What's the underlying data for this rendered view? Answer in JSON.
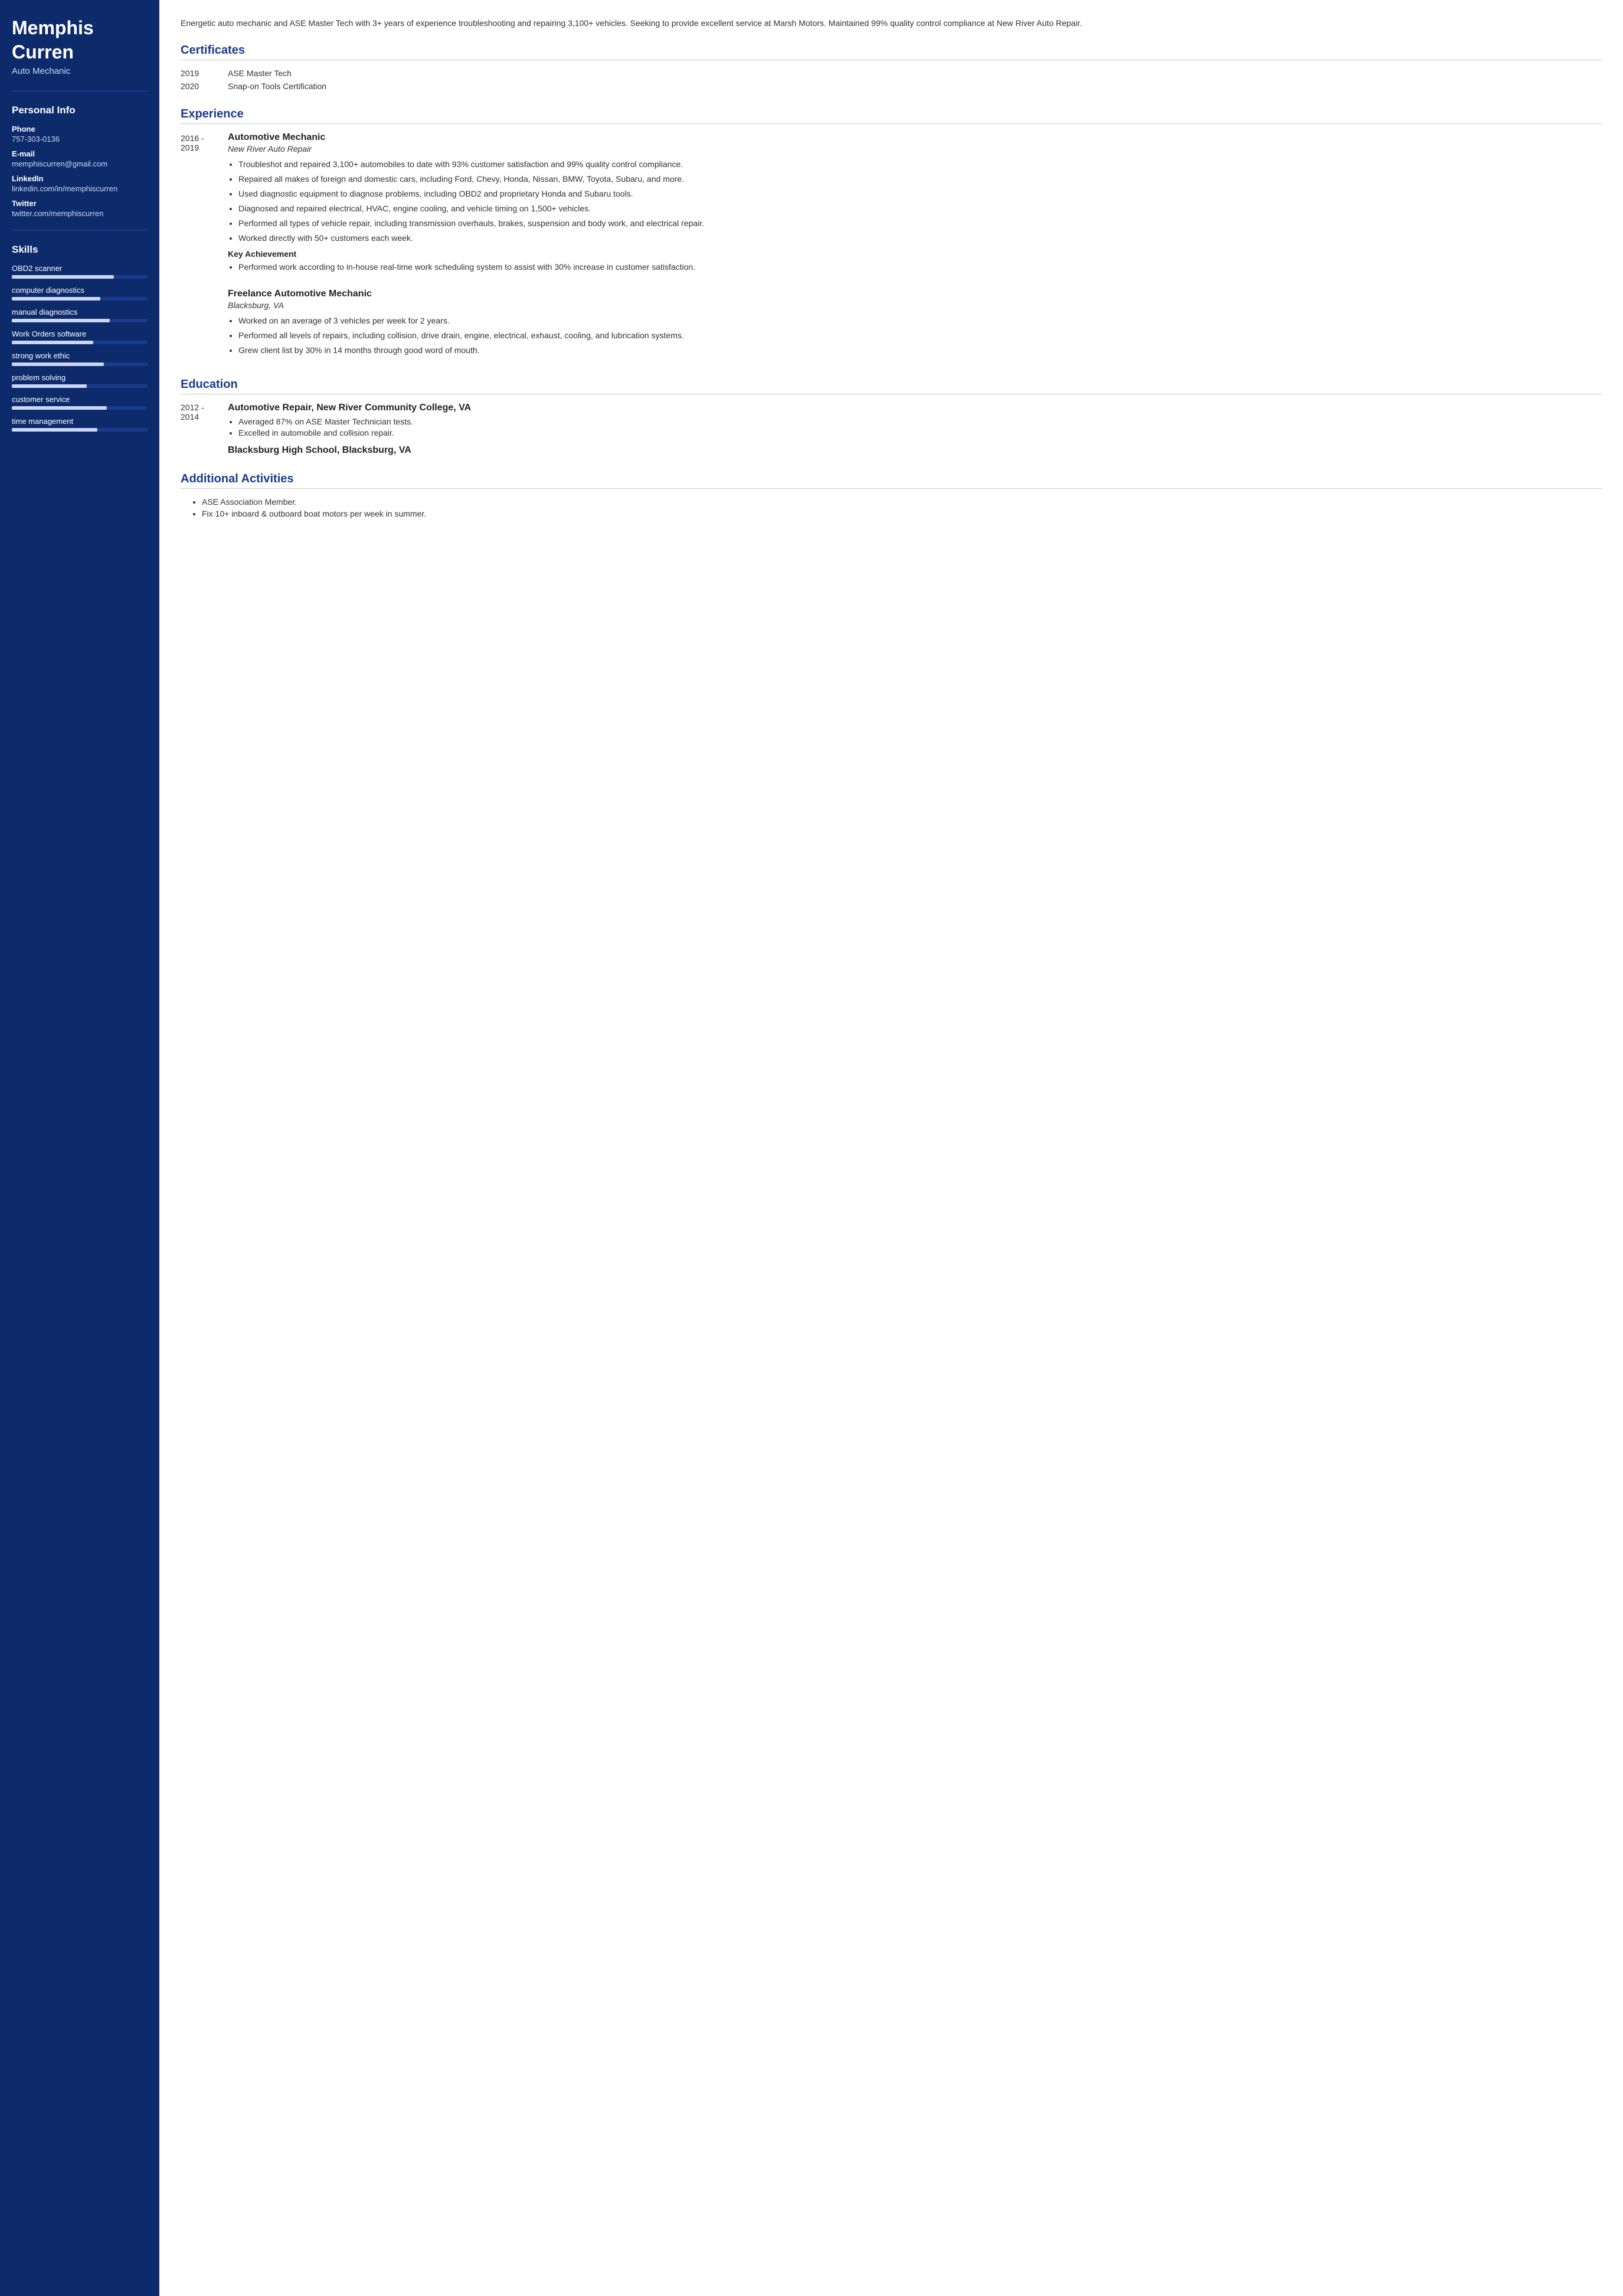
{
  "sidebar": {
    "name": "Memphis\nCurren",
    "name_line1": "Memphis",
    "name_line2": "Curren",
    "title": "Auto Mechanic",
    "personal_info_heading": "Personal Info",
    "phone_label": "Phone",
    "phone_value": "757-303-0136",
    "email_label": "E-mail",
    "email_value": "memphiscurren@gmail.com",
    "linkedin_label": "LinkedIn",
    "linkedin_value": "linkedin.com/in/memphiscurren",
    "twitter_label": "Twitter",
    "twitter_value": "twitter.com/memphiscurren",
    "skills_heading": "Skills",
    "skills": [
      {
        "name": "OBD2 scanner",
        "fill": 75,
        "total": 100
      },
      {
        "name": "computer diagnostics",
        "fill": 65,
        "total": 100
      },
      {
        "name": "manual diagnostics",
        "fill": 72,
        "total": 100
      },
      {
        "name": "Work Orders software",
        "fill": 60,
        "total": 100
      },
      {
        "name": "strong work ethic",
        "fill": 68,
        "total": 100
      },
      {
        "name": "problem solving",
        "fill": 55,
        "total": 100
      },
      {
        "name": "customer service",
        "fill": 70,
        "total": 100
      },
      {
        "name": "time management",
        "fill": 63,
        "total": 100
      }
    ]
  },
  "main": {
    "summary": "Energetic auto mechanic and ASE Master Tech with 3+ years of experience troubleshooting and repairing 3,100+ vehicles. Seeking to provide excellent service at Marsh Motors. Maintained 99% quality control compliance at New River Auto Repair.",
    "certificates_heading": "Certificates",
    "certificates": [
      {
        "year": "2019",
        "name": "ASE Master Tech"
      },
      {
        "year": "2020",
        "name": "Snap-on Tools Certification"
      }
    ],
    "experience_heading": "Experience",
    "experience": [
      {
        "dates": "2016 -\n2019",
        "title": "Automotive Mechanic",
        "company": "New River Auto Repair",
        "bullets": [
          "Troubleshot and repaired 3,100+ automobiles to date with 93% customer satisfaction and 99% quality control compliance.",
          "Repaired all makes of foreign and domestic cars, including Ford, Chevy, Honda, Nissan, BMW, Toyota, Subaru, and more.",
          "Used diagnostic equipment to diagnose problems, including OBD2 and proprietary Honda and Subaru tools.",
          "Diagnosed and repaired electrical, HVAC, engine cooling, and vehicle timing on 1,500+ vehicles.",
          "Performed all types of vehicle repair, including transmission overhauls, brakes, suspension and body work, and electrical repair.",
          "Worked directly with 50+ customers each week."
        ],
        "key_achievement_label": "Key Achievement",
        "key_achievement_bullets": [
          "Performed work according to in-house real-time work scheduling system to assist with 30% increase in customer satisfaction."
        ]
      },
      {
        "dates": "",
        "title": "Freelance Automotive Mechanic",
        "company": "Blacksburg, VA",
        "bullets": [
          "Worked on an average of 3 vehicles per week for 2 years.",
          "Performed all levels of repairs, including collision, drive drain, engine, electrical, exhaust, cooling, and lubrication systems.",
          "Grew client list by 30% in 14 months through good word of mouth."
        ],
        "key_achievement_label": "",
        "key_achievement_bullets": []
      }
    ],
    "education_heading": "Education",
    "education": [
      {
        "dates": "2012 -\n2014",
        "title": "Automotive Repair, New River Community College, VA",
        "bullets": [
          "Averaged 87% on ASE Master Technician tests.",
          "Excelled in automobile and collision repair."
        ]
      }
    ],
    "education_school2": "Blacksburg High School, Blacksburg, VA",
    "additional_heading": "Additional Activities",
    "additional_bullets": [
      "ASE Association Member.",
      "Fix 10+ inboard & outboard boat motors per week in summer."
    ]
  }
}
